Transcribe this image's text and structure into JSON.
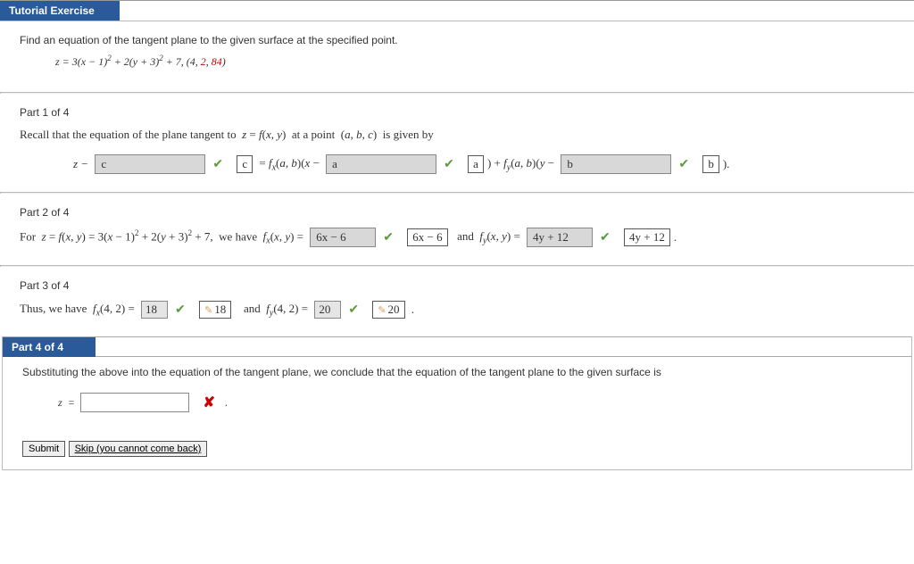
{
  "header": {
    "tutorial_label": "Tutorial Exercise"
  },
  "problem": {
    "prompt": "Find an equation of the tangent plane to the given surface at the specified point.",
    "equation_html": "z = 3(x − 1)² + 2(y + 3)² + 7, (4, 2, 84)"
  },
  "part1": {
    "label": "Part 1 of 4",
    "intro_html": "Recall that the equation of the plane tangent to  z = f(x, y)  at a point  (a, b, c)  is given by",
    "blank_c": "c",
    "confirm_c": "c",
    "blank_a": "a",
    "confirm_a": "a",
    "blank_b": "b",
    "confirm_b": "b"
  },
  "part2": {
    "label": "Part 2 of 4",
    "intro_html": "For  z = f(x, y) = 3(x − 1)² + 2(y + 3)² + 7,  we have  f",
    "fx_ans": "6x − 6",
    "fx_confirm": "6x − 6",
    "fy_ans": "4y + 12",
    "fy_confirm": "4y + 12"
  },
  "part3": {
    "label": "Part 3 of 4",
    "fx_val": "18",
    "fx_confirm": "18",
    "fy_val": "20",
    "fy_confirm": "20"
  },
  "part4": {
    "label": "Part 4 of 4",
    "text": "Substituting the above into the equation of the tangent plane, we conclude that the equation of the tangent plane to the given surface is"
  },
  "buttons": {
    "submit": "Submit",
    "skip": "Skip (you cannot come back)"
  }
}
